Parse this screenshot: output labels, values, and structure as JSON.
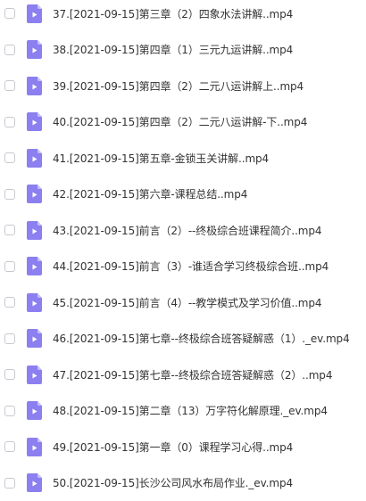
{
  "files": [
    {
      "name": "37.[2021-09-15]第三章（2）四象水法讲解..mp4"
    },
    {
      "name": "38.[2021-09-15]第四章（1）三元九运讲解..mp4"
    },
    {
      "name": "39.[2021-09-15]第四章（2）二元八运讲解上..mp4"
    },
    {
      "name": "40.[2021-09-15]第四章（2）二元八运讲解-下..mp4"
    },
    {
      "name": "41.[2021-09-15]第五章-金锁玉关讲解..mp4"
    },
    {
      "name": "42.[2021-09-15]第六章-课程总结..mp4"
    },
    {
      "name": "43.[2021-09-15]前言（2）--终极综合班课程简介..mp4"
    },
    {
      "name": "44.[2021-09-15]前言（3）-谁适合学习终极综合班..mp4"
    },
    {
      "name": "45.[2021-09-15]前言（4）--教学模式及学习价值..mp4"
    },
    {
      "name": "46.[2021-09-15]第七章--终极综合班答疑解惑（1）._ev.mp4"
    },
    {
      "name": "47.[2021-09-15]第七章--终极综合班答疑解惑（2）..mp4"
    },
    {
      "name": "48.[2021-09-15]第二章（13）万字符化解原理._ev.mp4"
    },
    {
      "name": "49.[2021-09-15]第一章（0）课程学习心得..mp4"
    },
    {
      "name": "50.[2021-09-15]长沙公司风水布局作业._ev.mp4"
    }
  ],
  "icon": "video-file-icon",
  "colors": {
    "icon_body": "#8c7ff0",
    "icon_fold": "#c8c0fb",
    "icon_play": "#ffffff",
    "text": "#333333",
    "checkbox_border": "#c7c9cf"
  }
}
